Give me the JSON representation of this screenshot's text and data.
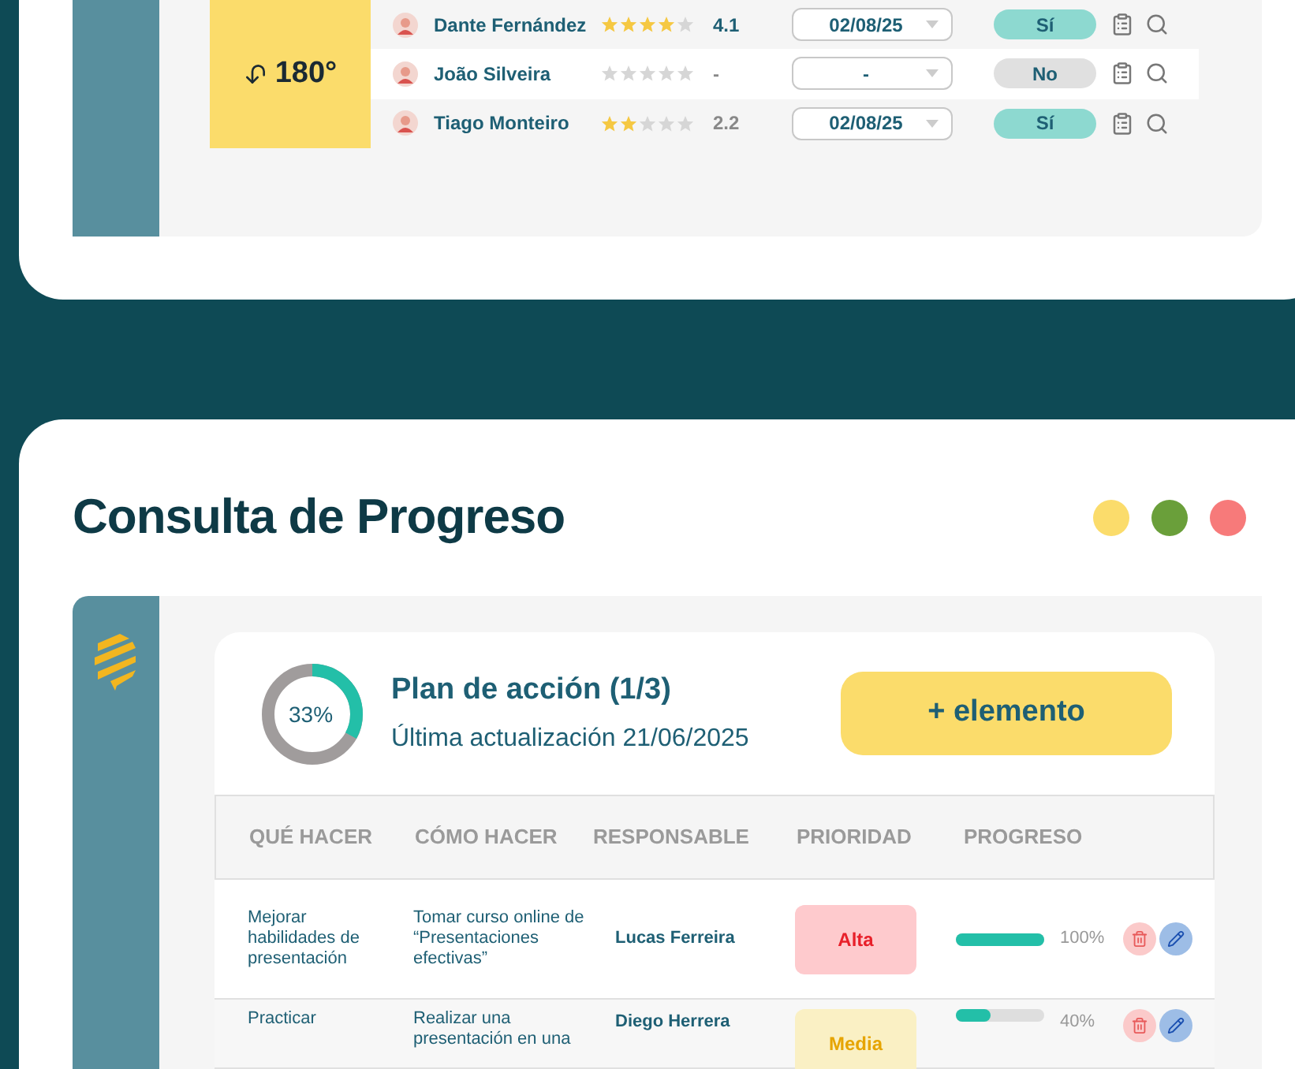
{
  "top_table": {
    "angle": "180°",
    "rows": [
      {
        "name": "Dante Fernández",
        "stars": 4,
        "rating": "4.1",
        "rating_muted": false,
        "date": "02/08/25",
        "answer": "Sí",
        "positive": true
      },
      {
        "name": "João Silveira",
        "stars": 0,
        "rating": "-",
        "rating_muted": true,
        "date": "-",
        "answer": "No",
        "positive": false
      },
      {
        "name": "Tiago Monteiro",
        "stars": 2,
        "rating": "2.2",
        "rating_muted": true,
        "date": "02/08/25",
        "answer": "Sí",
        "positive": true
      }
    ]
  },
  "section": {
    "title": "Consulta de Progreso",
    "dots": [
      {
        "color": "#fbdc6b"
      },
      {
        "color": "#6a9f3a"
      },
      {
        "color": "#f77a7a"
      }
    ]
  },
  "plan": {
    "percent": "33%",
    "level": 0.33,
    "title": "Plan de acción (1/3)",
    "updated": "Última actualización 21/06/2025",
    "add_button": "+ elemento",
    "columns": [
      "QUÉ HACER",
      "CÓMO HACER",
      "RESPONSABLE",
      "PRIORIDAD",
      "PROGRESO"
    ],
    "rows": [
      {
        "what": "Mejorar habilidades de presentación",
        "how": "Tomar curso online de “Presentaciones efectivas”",
        "owner": "Lucas Ferreira",
        "priority": "Alta",
        "kind": "high",
        "level": 1,
        "progress": "100%"
      },
      {
        "what": "Practicar",
        "how": "Realizar una presentación en una",
        "owner": "Diego Herrera",
        "priority": "Media",
        "kind": "medium",
        "level": 0.4,
        "progress": "40%"
      }
    ]
  }
}
